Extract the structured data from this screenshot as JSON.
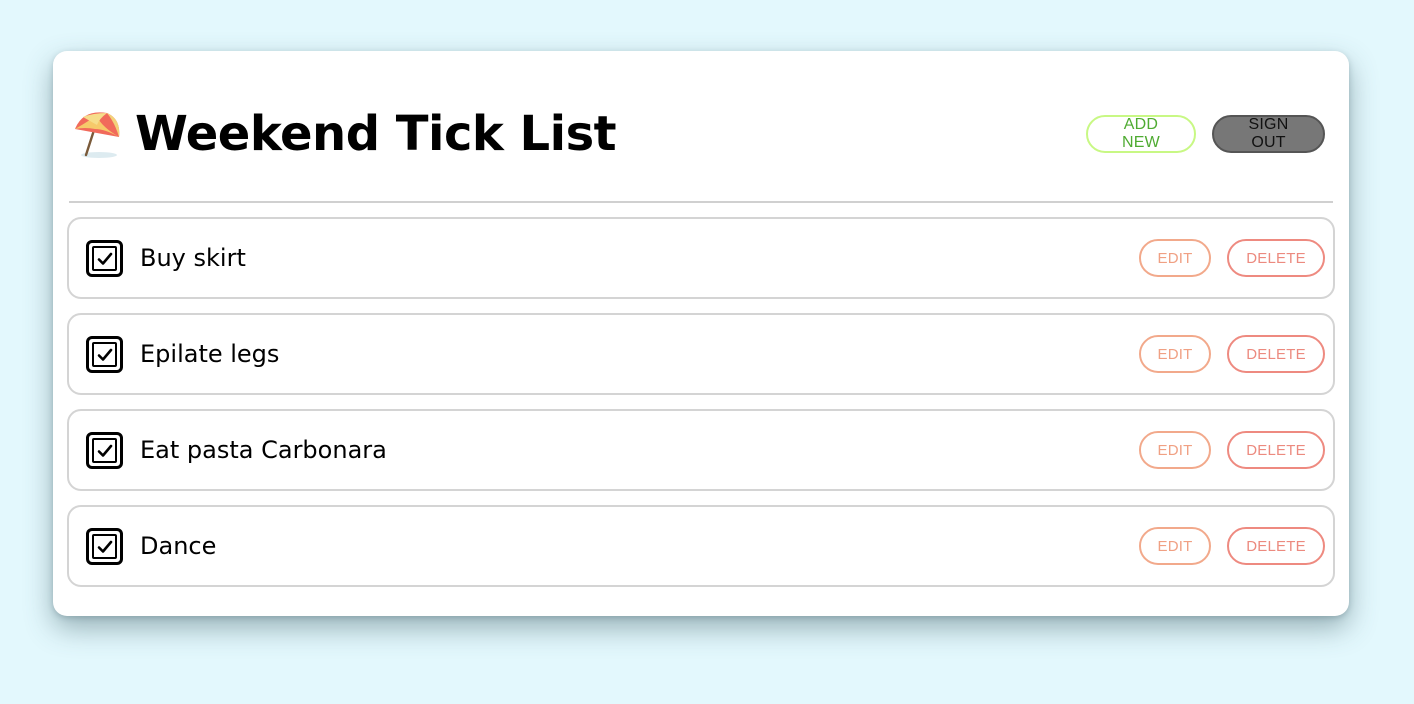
{
  "header": {
    "title": "Weekend Tick List",
    "icon": "beach-umbrella-icon",
    "add_new_label": "ADD NEW",
    "sign_out_label": "SIGN OUT"
  },
  "items": [
    {
      "label": "Buy skirt",
      "checked": true,
      "edit_label": "EDIT",
      "delete_label": "DELETE"
    },
    {
      "label": "Epilate legs",
      "checked": true,
      "edit_label": "EDIT",
      "delete_label": "DELETE"
    },
    {
      "label": "Eat pasta Carbonara",
      "checked": true,
      "edit_label": "EDIT",
      "delete_label": "DELETE"
    },
    {
      "label": "Dance",
      "checked": true,
      "edit_label": "EDIT",
      "delete_label": "DELETE"
    }
  ],
  "colors": {
    "background": "#e3f8fd",
    "card": "#ffffff",
    "add_new_border": "#c8f884",
    "add_new_text": "#4fab32",
    "sign_out_bg": "#777777",
    "edit_accent": "#f0a083",
    "delete_accent": "#ec8a7f"
  }
}
